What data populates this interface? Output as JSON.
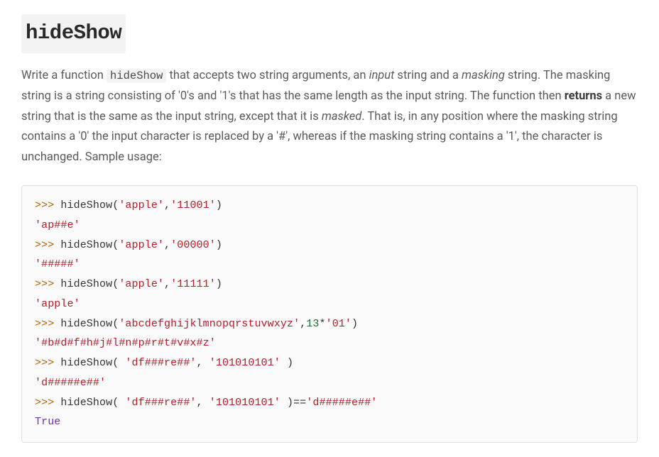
{
  "heading": "hideShow",
  "description": {
    "pre1": "Write a function ",
    "code1": "hideShow",
    "post1": " that accepts two string arguments, an ",
    "em1": "input",
    "post2": " string and a ",
    "em2": "masking",
    "post3": " string. The masking string is a string consisting of '0's and '1's that has the same length as the input string.  The function then ",
    "strong1": "returns",
    "post4": " a new string that is the same as the input string, except that it is ",
    "em3": "masked",
    "post5": ". That is, in any position where the masking string contains a '0' the input character is replaced by a '#', whereas if the masking string contains a '1', the character is unchanged. Sample usage:"
  },
  "code": {
    "prompt": ">>> ",
    "fn": "hideShow",
    "op_mul": "*",
    "op_eq": "==",
    "bool_true": "True",
    "lines": [
      {
        "type": "call",
        "args": [
          "'apple'",
          "'11001'"
        ]
      },
      {
        "type": "output",
        "value": "'ap##e'"
      },
      {
        "type": "call",
        "args": [
          "'apple'",
          "'00000'"
        ]
      },
      {
        "type": "output",
        "value": "'#####'"
      },
      {
        "type": "call",
        "args": [
          "'apple'",
          "'11111'"
        ]
      },
      {
        "type": "output",
        "value": "'apple'"
      },
      {
        "type": "call_special",
        "arg1": "'abcdefghijklmnopqrstuvwxyz'",
        "num": "13",
        "arg2b": "'01'"
      },
      {
        "type": "output",
        "value": "'#b#d#f#h#j#l#n#p#r#t#v#x#z'"
      },
      {
        "type": "call_spaced",
        "args": [
          "'df###re##'",
          "'101010101'"
        ]
      },
      {
        "type": "output",
        "value": "'d#####e##'"
      },
      {
        "type": "call_spaced_eq",
        "args": [
          "'df###re##'",
          "'101010101'"
        ],
        "rhs": "'d#####e##'"
      },
      {
        "type": "bool_out"
      }
    ]
  }
}
